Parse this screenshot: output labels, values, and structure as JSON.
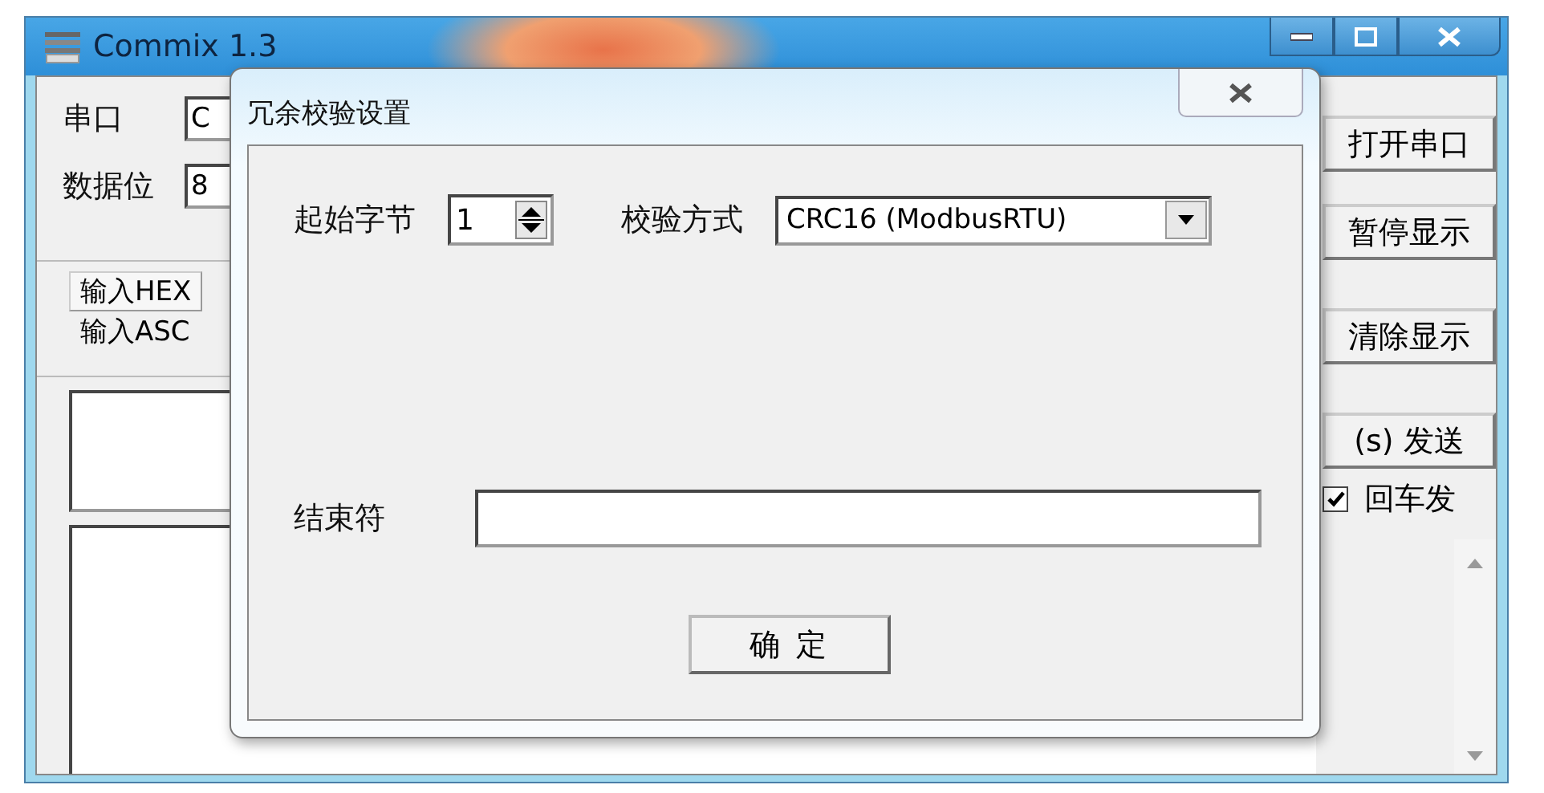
{
  "main_window": {
    "title": "Commix 1.3",
    "port_label": "串口",
    "port_value": "C",
    "databits_label": "数据位",
    "databits_value": "8",
    "input_modes": [
      {
        "label": "输入HEX",
        "selected": true
      },
      {
        "label": "输入ASC",
        "selected": false
      }
    ],
    "buttons": [
      "打开串口",
      "暂停显示",
      "清除显示",
      "(s) 发送"
    ],
    "enter_send": {
      "label": "回车发",
      "checked": true
    }
  },
  "dialog": {
    "title": "冗余校验设置",
    "start_byte": {
      "label": "起始字节",
      "value": "1"
    },
    "check_method": {
      "label": "校验方式",
      "value": "CRC16 (ModbusRTU)"
    },
    "terminator": {
      "label": "结束符"
    },
    "ok_button": "确 定"
  }
}
